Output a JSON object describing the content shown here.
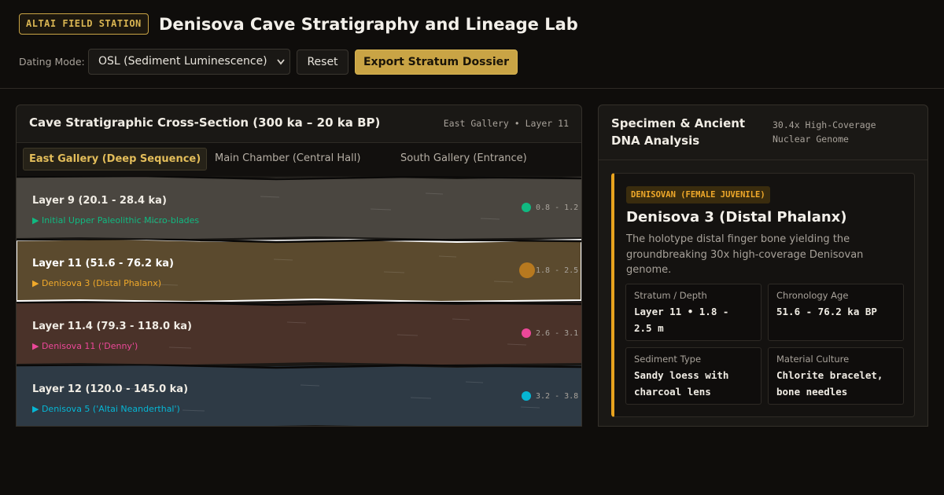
{
  "header": {
    "badge": "ALTAI FIELD STATION",
    "title": "Denisova Cave Stratigraphy and Lineage Lab",
    "dating_mode_label": "Dating Mode:",
    "dating_mode_value": "OSL (Sediment Luminescence)",
    "reset_label": "Reset",
    "export_label": "Export Stratum Dossier"
  },
  "stratigraphy": {
    "title": "Cave Stratigraphic Cross-Section (300 ka – 20 ka BP)",
    "location": "East Gallery • Layer 11",
    "tabs": [
      {
        "label": "East Gallery (Deep Sequence)",
        "active": true
      },
      {
        "label": "Main Chamber (Central Hall)",
        "active": false
      },
      {
        "label": "South Gallery (Entrance)",
        "active": false
      }
    ],
    "layers": [
      {
        "name": "Layer 9 (20.1 - 28.4 ka)",
        "finding": "▶ Initial Upper Paleolithic Micro-blades",
        "depth": "0.8 - 1.2",
        "color": "#4a4640",
        "marker": "#10b981",
        "selected": false
      },
      {
        "name": "Layer 11 (51.6 - 76.2 ka)",
        "finding": "▶ Denisova 3 (Distal Phalanx)",
        "depth": "1.8 - 2.5",
        "color": "#5b4a2e",
        "marker": "#b7791f",
        "selected": true
      },
      {
        "name": "Layer 11.4 (79.3 - 118.0 ka)",
        "finding": "▶ Denisova 11 ('Denny')",
        "depth": "2.6 - 3.1",
        "color": "#4a3229",
        "marker": "#ec4899",
        "selected": false
      },
      {
        "name": "Layer 12 (120.0 - 145.0 ka)",
        "finding": "▶ Denisova 5 ('Altai Neanderthal')",
        "depth": "3.2 - 3.8",
        "color": "#2e3a45",
        "marker": "#06b6d4",
        "selected": false
      }
    ]
  },
  "specimen": {
    "title": "Specimen & Ancient DNA Analysis",
    "genome_meta": "30.4x High-Coverage Nuclear Genome",
    "lineage": "DENISOVAN (FEMALE JUVENILE)",
    "name": "Denisova 3 (Distal Phalanx)",
    "description": "The holotype distal finger bone yielding the groundbreaking 30x high-coverage Denisovan genome.",
    "accent": "#e8a31e",
    "details": [
      {
        "label": "Stratum / Depth",
        "value": "Layer 11 • 1.8 - 2.5 m"
      },
      {
        "label": "Chronology Age",
        "value": "51.6 - 76.2 ka BP"
      },
      {
        "label": "Sediment Type",
        "value": "Sandy loess with charcoal lens"
      },
      {
        "label": "Material Culture",
        "value": "Chlorite bracelet, bone needles"
      }
    ]
  }
}
